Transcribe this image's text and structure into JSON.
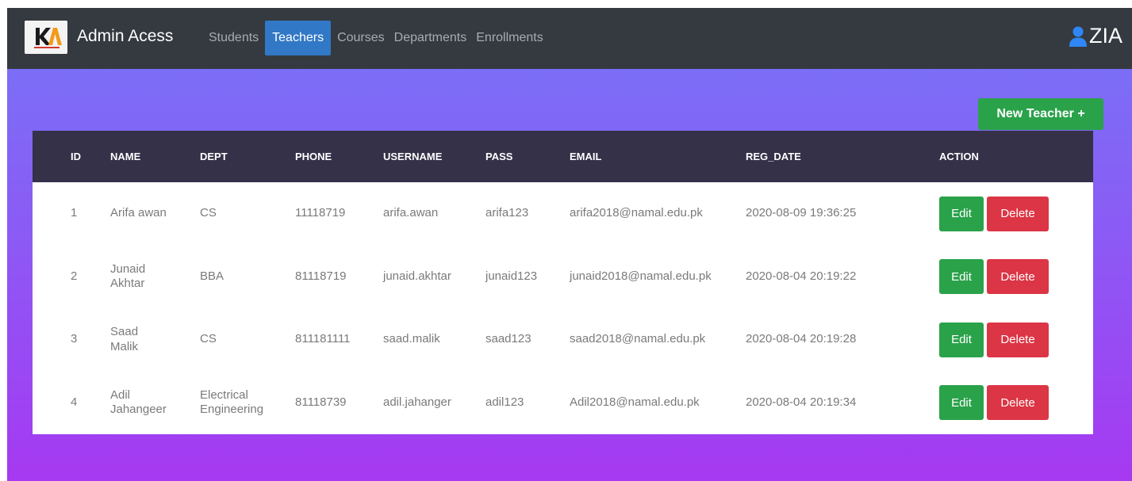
{
  "nav": {
    "brand": "Admin Acess",
    "items": [
      {
        "label": "Students",
        "active": false
      },
      {
        "label": "Teachers",
        "active": true
      },
      {
        "label": "Courses",
        "active": false
      },
      {
        "label": "Departments",
        "active": false
      },
      {
        "label": "Enrollments",
        "active": false
      }
    ],
    "user": "ZIA"
  },
  "toolbar": {
    "new_label": "New Teacher +"
  },
  "table": {
    "headers": [
      "ID",
      "NAME",
      "DEPT",
      "PHONE",
      "USERNAME",
      "PASS",
      "EMAIL",
      "REG_DATE",
      "ACTION"
    ],
    "rows": [
      {
        "id": "1",
        "name": "Arifa awan",
        "dept": "CS",
        "phone": "11118719",
        "username": "arifa.awan",
        "pass": "arifa123",
        "email": "arifa2018@namal.edu.pk",
        "reg_date": "2020-08-09 19:36:25"
      },
      {
        "id": "2",
        "name": "Junaid Akhtar",
        "dept": "BBA",
        "phone": "81118719",
        "username": "junaid.akhtar",
        "pass": "junaid123",
        "email": "junaid2018@namal.edu.pk",
        "reg_date": "2020-08-04 20:19:22"
      },
      {
        "id": "3",
        "name": "Saad Malik",
        "dept": "CS",
        "phone": "811181111",
        "username": "saad.malik",
        "pass": "saad123",
        "email": "saad2018@namal.edu.pk",
        "reg_date": "2020-08-04 20:19:28"
      },
      {
        "id": "4",
        "name": "Adil Jahangeer",
        "dept": "Electrical Engineering",
        "phone": "81118739",
        "username": "adil.jahanger",
        "pass": "adil123",
        "email": "Adil2018@namal.edu.pk",
        "reg_date": "2020-08-04 20:19:34"
      }
    ],
    "edit_label": "Edit",
    "delete_label": "Delete"
  },
  "colors": {
    "navbar": "#353a40",
    "active_tab": "#3178c6",
    "success": "#2aa24a",
    "danger": "#dc3545",
    "table_header": "#343149",
    "bg_top": "#7575f6",
    "bg_bottom": "#a639f1"
  },
  "icons": {
    "user": "user-icon",
    "logo": "ka-logo"
  }
}
